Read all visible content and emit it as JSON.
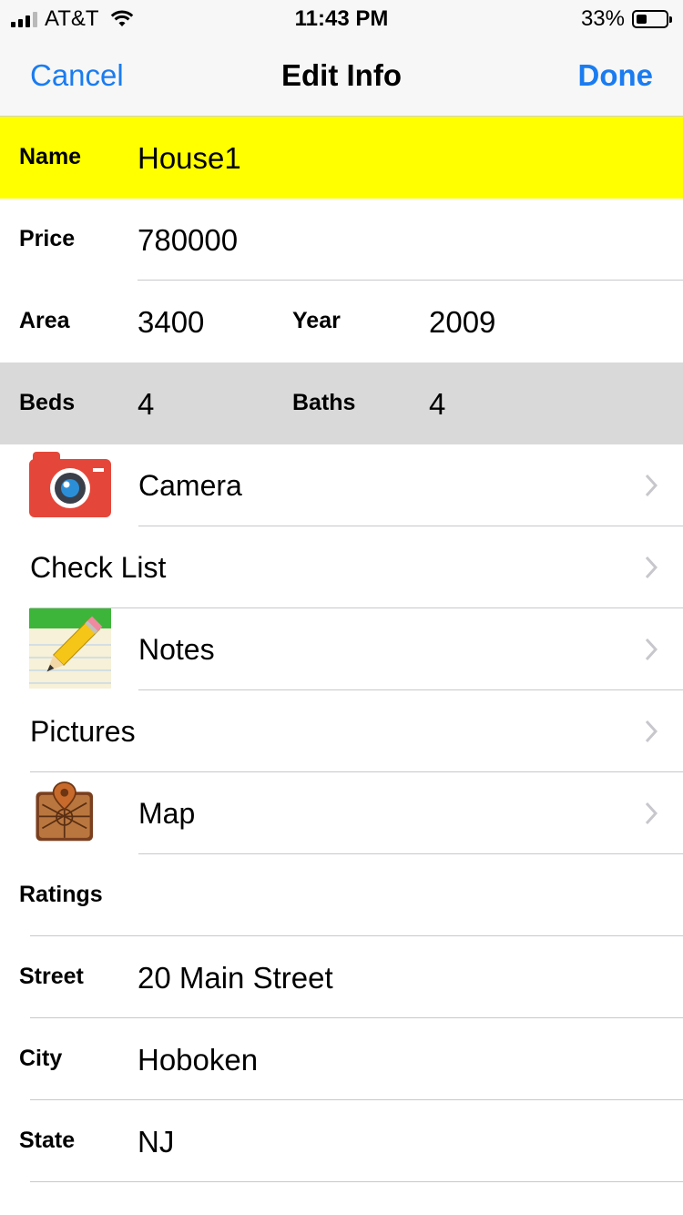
{
  "status_bar": {
    "carrier": "AT&T",
    "time": "11:43 PM",
    "battery_percent": "33%",
    "battery_level": 0.33,
    "signal_bars": 3,
    "signal_icon": "signal-icon",
    "wifi_icon": "wifi-icon"
  },
  "nav": {
    "cancel_label": "Cancel",
    "title": "Edit Info",
    "done_label": "Done",
    "accent_color": "#1a7cf0"
  },
  "fields": {
    "name": {
      "label": "Name",
      "value": "House1",
      "highlight_color": "#ffff00"
    },
    "price": {
      "label": "Price",
      "value": "780000"
    },
    "area": {
      "label": "Area",
      "value": "3400"
    },
    "year": {
      "label": "Year",
      "value": "2009"
    },
    "beds": {
      "label": "Beds",
      "value": "4",
      "row_color": "#d9d9d9"
    },
    "baths": {
      "label": "Baths",
      "value": "4"
    }
  },
  "menu": [
    {
      "label": "Camera",
      "icon": "camera-icon"
    },
    {
      "label": "Check List",
      "icon": ""
    },
    {
      "label": "Notes",
      "icon": "notes-pencil-icon"
    },
    {
      "label": "Pictures",
      "icon": ""
    },
    {
      "label": "Map",
      "icon": "map-icon"
    }
  ],
  "ratings": {
    "label": "Ratings"
  },
  "address": {
    "street": {
      "label": "Street",
      "value": "20 Main Street"
    },
    "city": {
      "label": "City",
      "value": "Hoboken"
    },
    "state": {
      "label": "State",
      "value": "NJ"
    }
  }
}
